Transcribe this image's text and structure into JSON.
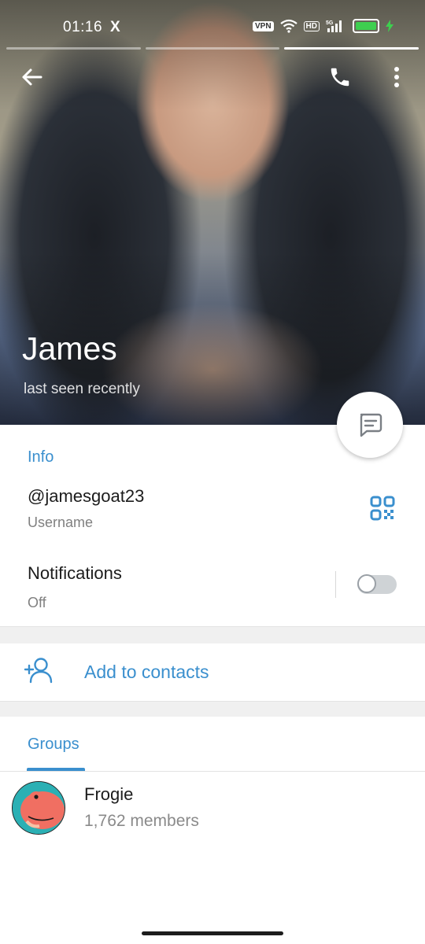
{
  "status_bar": {
    "time": "01:16",
    "app_icon": "X",
    "vpn": "VPN",
    "hd": "HD",
    "network": "5G",
    "battery_level": 0.85
  },
  "header": {
    "back_icon": "arrow-left-icon",
    "call_icon": "phone-icon",
    "menu_icon": "more-vertical-icon",
    "story_segments": 3,
    "active_segment": 3
  },
  "profile": {
    "name": "James",
    "status": "last seen recently"
  },
  "info": {
    "section_title": "Info",
    "username_value": "@jamesgoat23",
    "username_label": "Username",
    "notifications_label": "Notifications",
    "notifications_value": "Off"
  },
  "actions": {
    "add_contact_label": "Add to contacts"
  },
  "groups": {
    "tab_label": "Groups",
    "items": [
      {
        "name": "Frogie",
        "members": "1,762 members"
      }
    ]
  },
  "colors": {
    "accent": "#3a8fce",
    "text_primary": "#1c1c1c",
    "text_secondary": "#808080",
    "separator": "#f0f0f0"
  }
}
